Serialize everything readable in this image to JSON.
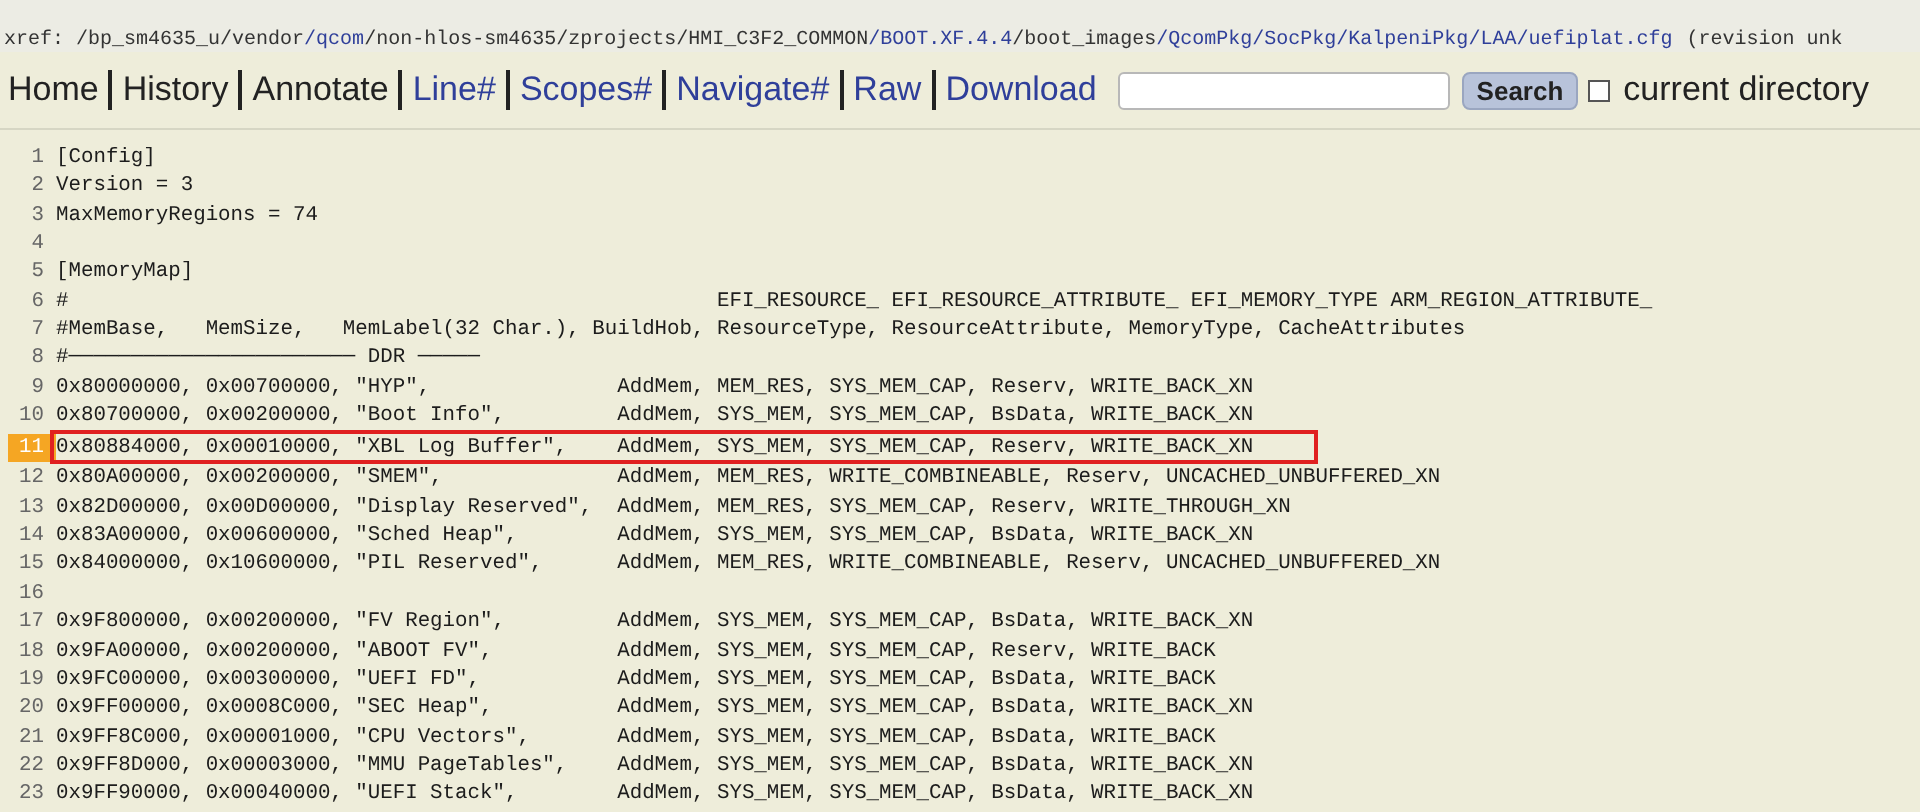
{
  "breadcrumb": {
    "label": "xref:",
    "segments": [
      {
        "text": "/bp_sm4635_u",
        "visited": true
      },
      {
        "text": "/vendor",
        "visited": true
      },
      {
        "text": "/qcom",
        "visited": false
      },
      {
        "text": "/non-hlos-sm4635",
        "visited": true
      },
      {
        "text": "/zprojects",
        "visited": true
      },
      {
        "text": "/HMI_C3F2_COMMON",
        "visited": true
      },
      {
        "text": "/BOOT.XF.4.4",
        "visited": false
      },
      {
        "text": "/boot_images",
        "visited": true
      },
      {
        "text": "/QcomPkg",
        "visited": false
      },
      {
        "text": "/SocPkg",
        "visited": false
      },
      {
        "text": "/KalpeniPkg",
        "visited": false
      },
      {
        "text": "/LAA",
        "visited": false
      },
      {
        "text": "/uefiplat.cfg",
        "visited": false
      }
    ],
    "revision": "(revision unk"
  },
  "nav": {
    "links": [
      {
        "label": "Home",
        "visited": true
      },
      {
        "label": "History",
        "visited": true
      },
      {
        "label": "Annotate",
        "visited": true
      },
      {
        "label": "Line#",
        "visited": false
      },
      {
        "label": "Scopes#",
        "visited": false
      },
      {
        "label": "Navigate#",
        "visited": false
      },
      {
        "label": "Raw",
        "visited": false
      },
      {
        "label": "Download",
        "visited": false
      }
    ],
    "search_button": "Search",
    "scope_checkbox": {
      "label": "current directory",
      "checked": false
    }
  },
  "code_lines": [
    {
      "number": "1",
      "text": "[Config]",
      "highlighted": false
    },
    {
      "number": "2",
      "text": "Version = 3",
      "highlighted": false
    },
    {
      "number": "3",
      "text": "MaxMemoryRegions = 74",
      "highlighted": false
    },
    {
      "number": "4",
      "highlighted": false
    },
    {
      "number": "5",
      "text": "[MemoryMap]",
      "highlighted": false
    },
    {
      "number": "6",
      "text": "#                                                    EFI_RESOURCE_ EFI_RESOURCE_ATTRIBUTE_ EFI_MEMORY_TYPE ARM_REGION_ATTRIBUTE_",
      "highlighted": false
    },
    {
      "number": "7",
      "text": "#MemBase,   MemSize,   MemLabel(32 Char.), BuildHob, ResourceType, ResourceAttribute, MemoryType, CacheAttributes",
      "highlighted": false
    },
    {
      "number": "8",
      "text": "#─────────────────────── DDR ─────",
      "highlighted": false
    },
    {
      "number": "9",
      "text": "0x80000000, 0x00700000, \"HYP\",               AddMem, MEM_RES, SYS_MEM_CAP, Reserv, WRITE_BACK_XN",
      "highlighted": false
    },
    {
      "number": "10",
      "text": "0x80700000, 0x00200000, \"Boot Info\",         AddMem, SYS_MEM, SYS_MEM_CAP, BsData, WRITE_BACK_XN",
      "highlighted": false
    },
    {
      "number": "11",
      "text": "0x80884000, 0x00010000, \"XBL Log Buffer\",    AddMem, SYS_MEM, SYS_MEM_CAP, Reserv, WRITE_BACK_XN",
      "highlighted": true
    },
    {
      "number": "12",
      "text": "0x80A00000, 0x00200000, \"SMEM\",              AddMem, MEM_RES, WRITE_COMBINEABLE, Reserv, UNCACHED_UNBUFFERED_XN",
      "highlighted": false
    },
    {
      "number": "13",
      "text": "0x82D00000, 0x00D00000, \"Display Reserved\",  AddMem, MEM_RES, SYS_MEM_CAP, Reserv, WRITE_THROUGH_XN",
      "highlighted": false
    },
    {
      "number": "14",
      "text": "0x83A00000, 0x00600000, \"Sched Heap\",        AddMem, SYS_MEM, SYS_MEM_CAP, BsData, WRITE_BACK_XN",
      "highlighted": false
    },
    {
      "number": "15",
      "text": "0x84000000, 0x10600000, \"PIL Reserved\",      AddMem, MEM_RES, WRITE_COMBINEABLE, Reserv, UNCACHED_UNBUFFERED_XN",
      "highlighted": false
    },
    {
      "number": "16",
      "highlighted": false
    },
    {
      "number": "17",
      "text": "0x9F800000, 0x00200000, \"FV Region\",         AddMem, SYS_MEM, SYS_MEM_CAP, BsData, WRITE_BACK_XN",
      "highlighted": false
    },
    {
      "number": "18",
      "text": "0x9FA00000, 0x00200000, \"ABOOT FV\",          AddMem, SYS_MEM, SYS_MEM_CAP, Reserv, WRITE_BACK",
      "highlighted": false
    },
    {
      "number": "19",
      "text": "0x9FC00000, 0x00300000, \"UEFI FD\",           AddMem, SYS_MEM, SYS_MEM_CAP, BsData, WRITE_BACK",
      "highlighted": false
    },
    {
      "number": "20",
      "text": "0x9FF00000, 0x0008C000, \"SEC Heap\",          AddMem, SYS_MEM, SYS_MEM_CAP, BsData, WRITE_BACK_XN",
      "highlighted": false
    },
    {
      "number": "21",
      "text": "0x9FF8C000, 0x00001000, \"CPU Vectors\",       AddMem, SYS_MEM, SYS_MEM_CAP, BsData, WRITE_BACK",
      "highlighted": false
    },
    {
      "number": "22",
      "text": "0x9FF8D000, 0x00003000, \"MMU PageTables\",    AddMem, SYS_MEM, SYS_MEM_CAP, BsData, WRITE_BACK_XN",
      "highlighted": false
    },
    {
      "number": "23",
      "text": "0x9FF90000, 0x00040000, \"UEFI Stack\",        AddMem, SYS_MEM, SYS_MEM_CAP, BsData, WRITE_BACK_XN",
      "highlighted": false
    }
  ]
}
